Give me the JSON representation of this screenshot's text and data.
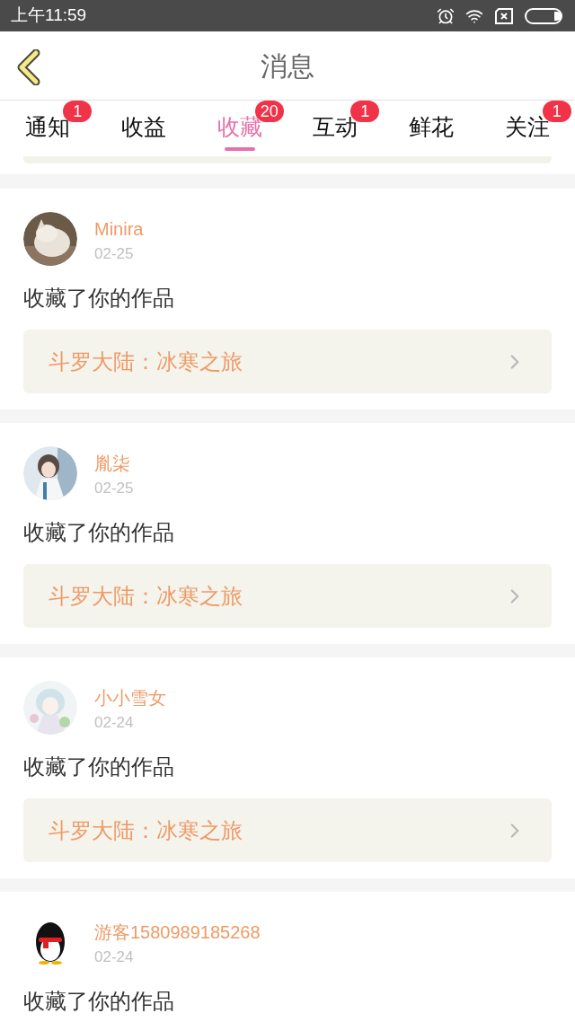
{
  "status_bar": {
    "time": "上午11:59"
  },
  "header": {
    "title": "消息"
  },
  "tabs": [
    {
      "label": "通知",
      "badge": "1",
      "selected": false
    },
    {
      "label": "收益",
      "selected": false
    },
    {
      "label": "收藏",
      "badge": "20",
      "selected": true
    },
    {
      "label": "互动",
      "badge": "1",
      "selected": false
    },
    {
      "label": "鲜花",
      "selected": false
    },
    {
      "label": "关注",
      "badge": "1",
      "selected": false
    }
  ],
  "messages": [
    {
      "user": "Minira",
      "date": "02-25",
      "text": "收藏了你的作品",
      "work": "斗罗大陆：冰寒之旅"
    },
    {
      "user": "胤柒",
      "date": "02-25",
      "text": "收藏了你的作品",
      "work": "斗罗大陆：冰寒之旅"
    },
    {
      "user": "小小雪女",
      "date": "02-24",
      "text": "收藏了你的作品",
      "work": "斗罗大陆：冰寒之旅"
    },
    {
      "user": "游客1580989185268",
      "date": "02-24",
      "text": "收藏了你的作品"
    }
  ]
}
